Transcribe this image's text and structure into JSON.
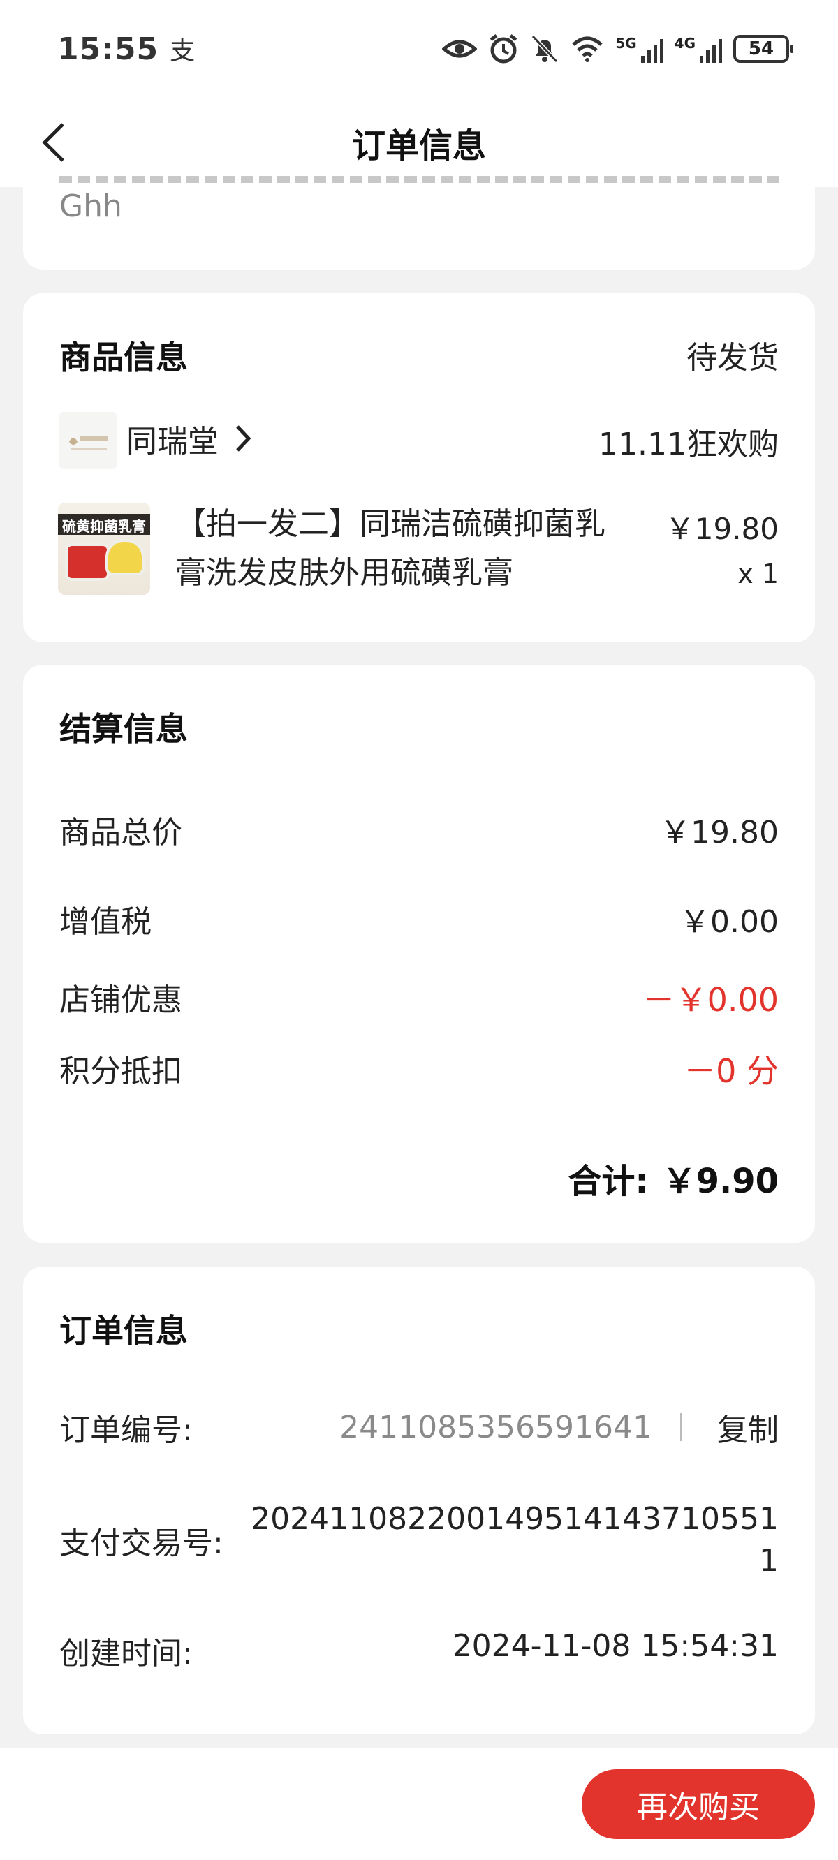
{
  "status_bar": {
    "time": "15:55",
    "app_glyph": "支",
    "signal_5g": "5G",
    "signal_4g": "4G",
    "battery": "54",
    "icons": [
      "eye-icon",
      "alarm-icon",
      "bell-off-icon",
      "wifi-icon",
      "signal-icon",
      "battery-icon"
    ]
  },
  "nav": {
    "title": "订单信息",
    "back_icon": "chevron-left-icon"
  },
  "address_card": {
    "partial_text": "Ghh"
  },
  "product_card": {
    "title": "商品信息",
    "status": "待发货",
    "store_name": "同瑞堂",
    "promo": "11.11狂欢购",
    "product_name": "【拍一发二】同瑞洁硫磺抑菌乳膏洗发皮肤外用硫磺乳膏",
    "product_name_line1": "【拍一发二】同瑞洁硫磺抑菌乳",
    "product_name_line2": "膏洗发皮肤外用硫磺乳膏",
    "price": "￥19.80",
    "quantity": "x 1",
    "thumb_label": "硫黄抑菌乳膏"
  },
  "settlement_card": {
    "title": "结算信息",
    "rows": [
      {
        "label": "商品总价",
        "value": "￥19.80"
      },
      {
        "label": "增值税",
        "value": "￥0.00"
      },
      {
        "label": "店铺优惠",
        "value": "－￥0.00"
      },
      {
        "label": "积分抵扣",
        "value": "－0 分"
      }
    ],
    "total_label": "合计:",
    "total_value": "￥9.90"
  },
  "order_card": {
    "title": "订单信息",
    "order_no_label": "订单编号:",
    "order_no": "2411085356591641",
    "copy_label": "复制",
    "trade_no_label": "支付交易号:",
    "trade_no_line1": "202411082200149514143710551",
    "trade_no_line2": "1",
    "created_label": "创建时间:",
    "created_at": "2024-11-08 15:54:31"
  },
  "bottom": {
    "rebuy_label": "再次购买"
  },
  "colors": {
    "accent": "#e2342c",
    "background": "#f2f2f2",
    "card": "#ffffff",
    "muted_text": "#8a8a8a"
  }
}
